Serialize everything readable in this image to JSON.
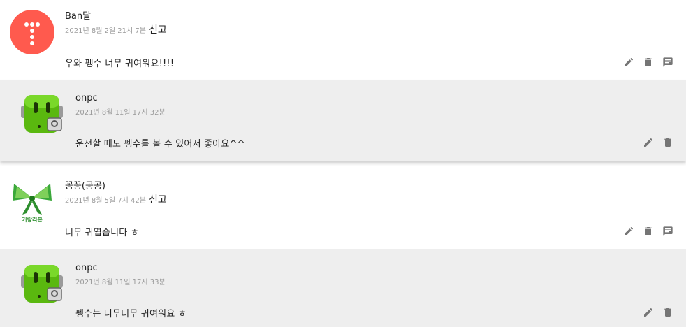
{
  "comments": [
    {
      "author": "Ban달",
      "date": "2021년 8월 2일 21시 7분",
      "report_label": "신고",
      "text": "우와 펭수 너무 귀여워요!!!!",
      "avatar_color": "#ff5a4e",
      "reply": {
        "author": "onpc",
        "date": "2021년 8월 11일 17시 32분",
        "text": "운전할 때도 펭수를 볼 수 있어서 좋아요^^"
      }
    },
    {
      "author": "꽁꽁(공공)",
      "date": "2021년 8월 5일 7시 42분",
      "report_label": "신고",
      "text": "너무 귀엽습니다 ㅎ",
      "avatar_caption": "커랑리본",
      "reply": {
        "author": "onpc",
        "date": "2021년 8월 11일 17시 33분",
        "text": "펭수는 너무너무 귀여워요 ㅎ"
      }
    }
  ],
  "icons": [
    "edit-icon",
    "delete-icon",
    "reply-icon"
  ]
}
